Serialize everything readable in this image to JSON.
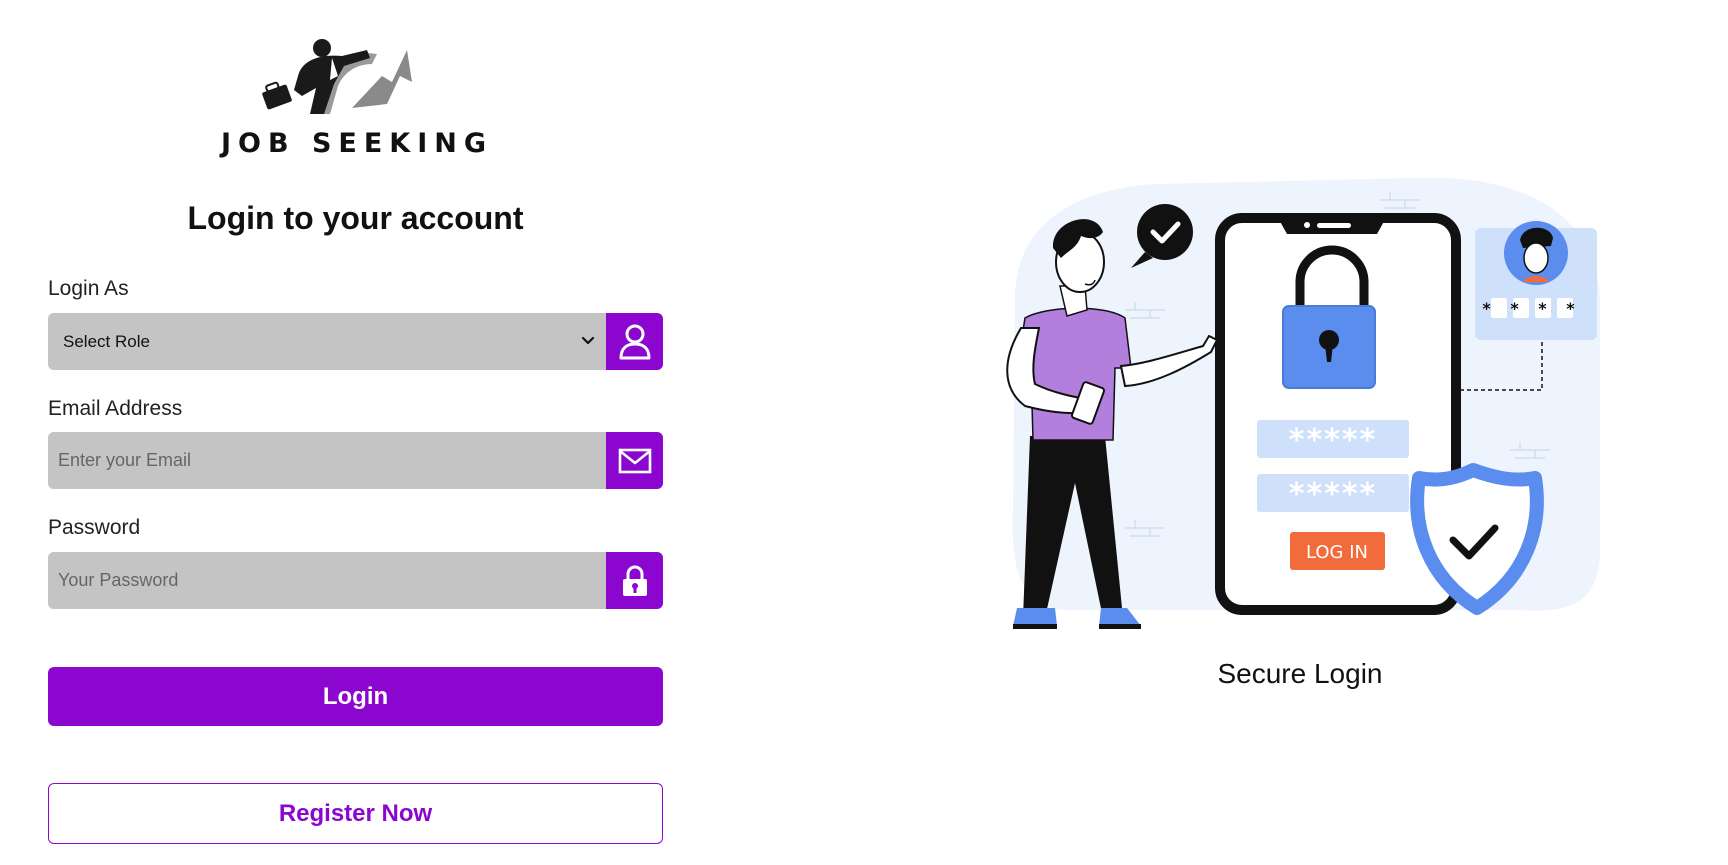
{
  "brand": {
    "name": "JOB SEEKING"
  },
  "form": {
    "title": "Login to your account",
    "role": {
      "label": "Login As",
      "selected": "Select Role",
      "icon": "user-icon"
    },
    "email": {
      "label": "Email Address",
      "placeholder": "Enter your Email",
      "value": "",
      "icon": "mail-icon"
    },
    "password": {
      "label": "Password",
      "placeholder": "Your Password",
      "value": "",
      "icon": "lock-icon"
    },
    "login_button": "Login",
    "register_button": "Register Now"
  },
  "illustration": {
    "caption": "Secure Login",
    "password_mask": "*****",
    "pin_mask": "* * * *",
    "phone_button": "LOG IN"
  },
  "colors": {
    "accent": "#8b07cf",
    "field_bg": "#c4c4c4",
    "illustration_blue": "#5b8def",
    "illustration_orange": "#f26b3a",
    "shirt_purple": "#b27fdc"
  }
}
